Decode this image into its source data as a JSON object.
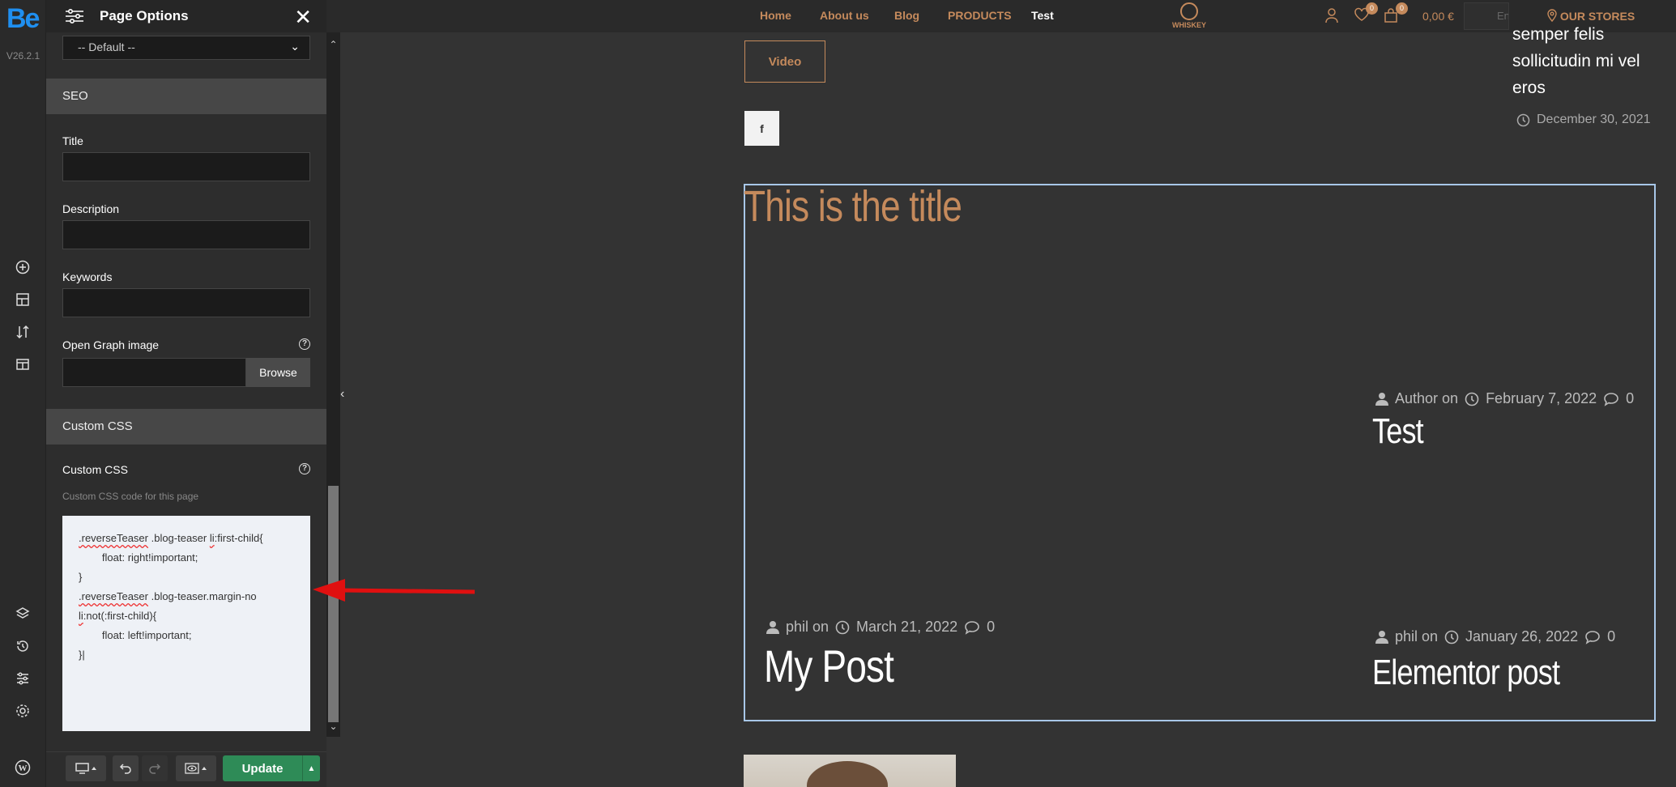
{
  "rail": {
    "logo": "Be",
    "version": "V26.2.1"
  },
  "panel": {
    "title": "Page Options",
    "template_select": "-- Default --",
    "seo_header": "SEO",
    "fields": {
      "title_label": "Title",
      "description_label": "Description",
      "keywords_label": "Keywords",
      "og_image_label": "Open Graph image",
      "browse_label": "Browse"
    },
    "custom_css_header": "Custom CSS",
    "custom_css_label": "Custom CSS",
    "custom_css_hint": "Custom CSS code for this page",
    "css_code": {
      "l1_sq": ".reverseTeaser",
      "l1_rest": " .blog-teaser ",
      "l1_sq2": "li",
      "l1_tail": ":first-child{",
      "l2": "        float: right!important;",
      "l3": "}",
      "l4_sq": ".reverseTeaser",
      "l4_rest": " .blog-teaser.margin-no",
      "l5_sq": "li",
      "l5_tail": ":not(:first-child){",
      "l6": "        float: left!important;",
      "l7": "}|"
    }
  },
  "footer": {
    "update_label": "Update"
  },
  "nav": {
    "links": [
      "Home",
      "About us",
      "Blog",
      "PRODUCTS",
      "Test"
    ],
    "brand": "WHISKEY",
    "wishlist_count": "0",
    "cart_count": "0",
    "cart_total": "0,00 €",
    "search_placeholder": "Ent",
    "stores": "OUR STORES"
  },
  "content": {
    "video_button": "Video",
    "fb_label": "f",
    "side_text_1": "semper felis",
    "side_text_2": "sollicitudin mi vel",
    "side_text_3": "eros",
    "side_date": "December 30, 2021",
    "section_title": "This is the title",
    "posts": [
      {
        "author": "Author on",
        "date": "February 7, 2022",
        "comments": "0",
        "title": "Test"
      },
      {
        "author": "phil on",
        "date": "March 21, 2022",
        "comments": "0",
        "title": "My Post"
      },
      {
        "author": "phil on",
        "date": "January 26, 2022",
        "comments": "0",
        "title": "Elementor post"
      }
    ]
  },
  "colors": {
    "accent": "#c58a5c",
    "update_green": "#2e8b57",
    "selection_border": "#a8c7e8",
    "arrow_red": "#e01010"
  }
}
